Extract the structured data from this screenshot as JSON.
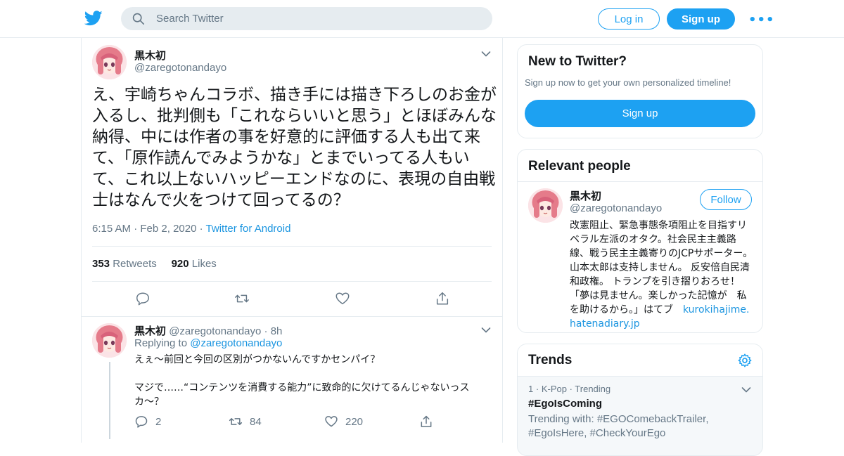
{
  "header": {
    "search_placeholder": "Search Twitter",
    "login_label": "Log in",
    "signup_label": "Sign up",
    "more_label": "•••",
    "brand_color": "#1da1f2"
  },
  "tweet": {
    "name": "黒木初",
    "handle": "@zaregotonandayo",
    "text": "え、宇崎ちゃんコラボ、描き手には描き下ろしのお金が入るし、批判側も「これならいいと思う」とほぼみんな納得、中には作者の事を好意的に評価する人も出て来て、「原作読んでみようかな」とまでいってる人もいて、これ以上ないハッピーエンドなのに、表現の自由戦士はなんで火をつけて回ってるの？",
    "time": "6:15 AM",
    "date": "Feb 2, 2020",
    "source": "Twitter for Android",
    "retweets": "353",
    "retweets_label": "Retweets",
    "likes": "920",
    "likes_label": "Likes"
  },
  "reply": {
    "name": "黒木初",
    "handle": "@zaregotonandayo",
    "age": "8h",
    "replying_label": "Replying to",
    "replying_to": "@zaregotonandayo",
    "line1": "えぇ〜前回と今回の区別がつかないんですかセンパイ？",
    "line2": "マジで……“コンテンツを消費する能力”に致命的に欠けてるんじゃないっスカ〜？",
    "replies": "2",
    "retweets": "84",
    "likes": "220"
  },
  "new_to_twitter": {
    "title": "New to Twitter?",
    "subtitle": "Sign up now to get your own personalized timeline!",
    "button": "Sign up"
  },
  "relevant_people": {
    "title": "Relevant people",
    "name": "黒木初",
    "handle": "@zaregotonandayo",
    "follow_label": "Follow",
    "bio": "改憲阻止、緊急事態条項阻止を目指すリベラル左派のオタク。社会民主主義路線、戦う民主主義寄りのJCPサポーター。山本太郎は支持しません。 反安倍自民清和政権。 トランプを引き摺りおろせ！ 「夢は見ません。楽しかった記憶が　私を助けるから。」はてブ　",
    "bio_link": "kurokihajime.hatenadiary.jp"
  },
  "trends": {
    "title": "Trends",
    "items": [
      {
        "rank": "1",
        "category": "K-Pop",
        "status": "Trending",
        "name": "#EgoIsComing",
        "trending_with": "Trending with: #EGOComebackTrailer, #EgoIsHere, #CheckYourEgo"
      }
    ]
  }
}
